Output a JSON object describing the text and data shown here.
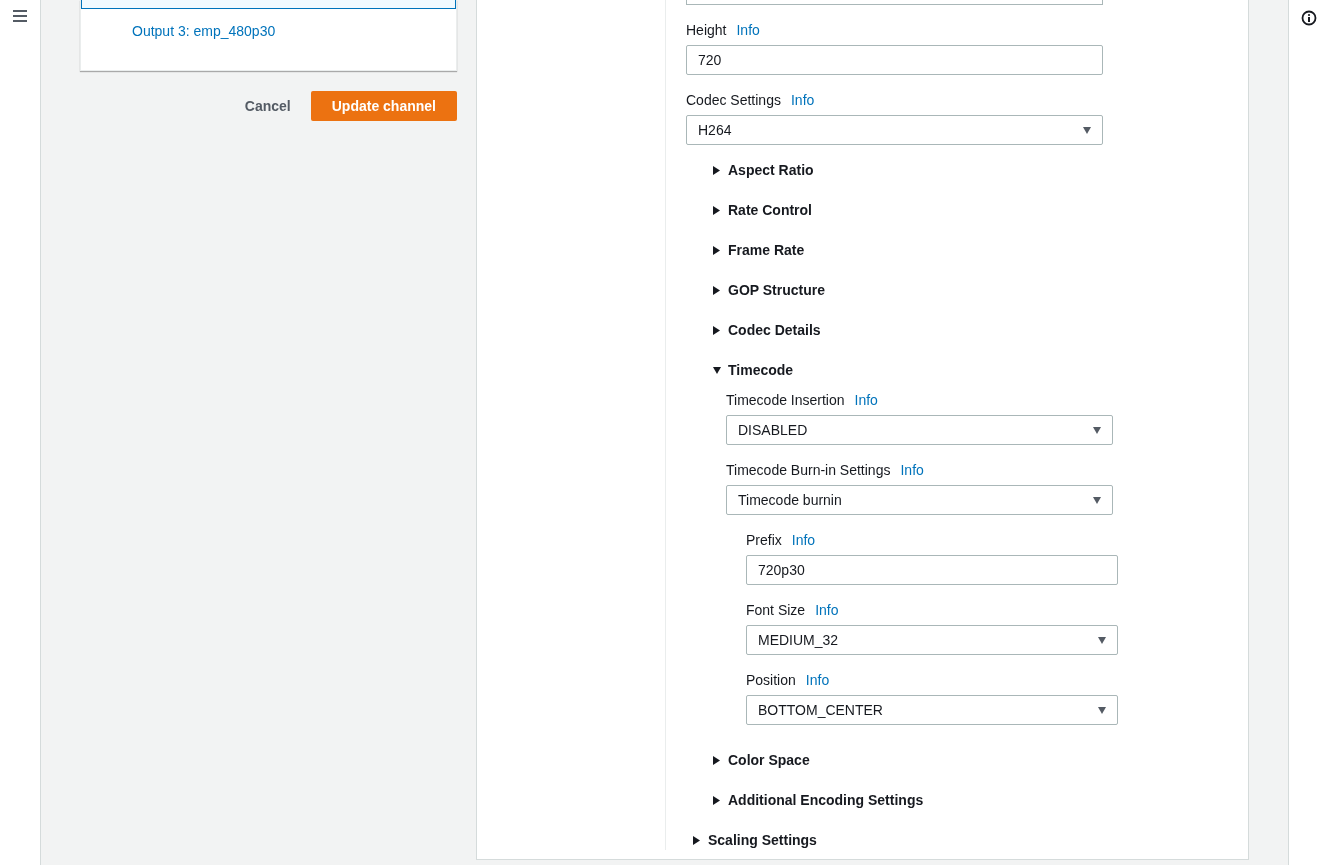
{
  "outputs": [
    {
      "selected": true
    },
    {
      "label": "Output 3: emp_480p30",
      "selected": false
    }
  ],
  "actions": {
    "cancel": "Cancel",
    "submit": "Update channel"
  },
  "video_fields": [
    {
      "kind": "input"
    },
    {
      "kind": "input",
      "label": "Height",
      "info": "Info",
      "value": "720"
    },
    {
      "kind": "select",
      "label": "Codec Settings",
      "info": "Info",
      "value": "H264"
    }
  ],
  "sections": [
    {
      "title": "Aspect Ratio",
      "expanded": false
    },
    {
      "title": "Rate Control",
      "expanded": false
    },
    {
      "title": "Frame Rate",
      "expanded": false
    },
    {
      "title": "GOP Structure",
      "expanded": false
    },
    {
      "title": "Codec Details",
      "expanded": false
    },
    {
      "title": "Timecode",
      "expanded": true,
      "fields": [
        {
          "kind": "select",
          "label": "Timecode Insertion",
          "info": "Info",
          "value": "DISABLED"
        },
        {
          "kind": "select",
          "label": "Timecode Burn-in Settings",
          "info": "Info",
          "value": "Timecode burnin",
          "children": [
            {
              "kind": "input",
              "label": "Prefix",
              "info": "Info",
              "value": "720p30"
            },
            {
              "kind": "select",
              "label": "Font Size",
              "info": "Info",
              "value": "MEDIUM_32"
            },
            {
              "kind": "select",
              "label": "Position",
              "info": "Info",
              "value": "BOTTOM_CENTER"
            }
          ]
        }
      ]
    },
    {
      "title": "Color Space",
      "expanded": false
    },
    {
      "title": "Additional Encoding Settings",
      "expanded": false
    }
  ],
  "outer_sections": [
    {
      "title": "Scaling Settings",
      "expanded": false
    }
  ]
}
